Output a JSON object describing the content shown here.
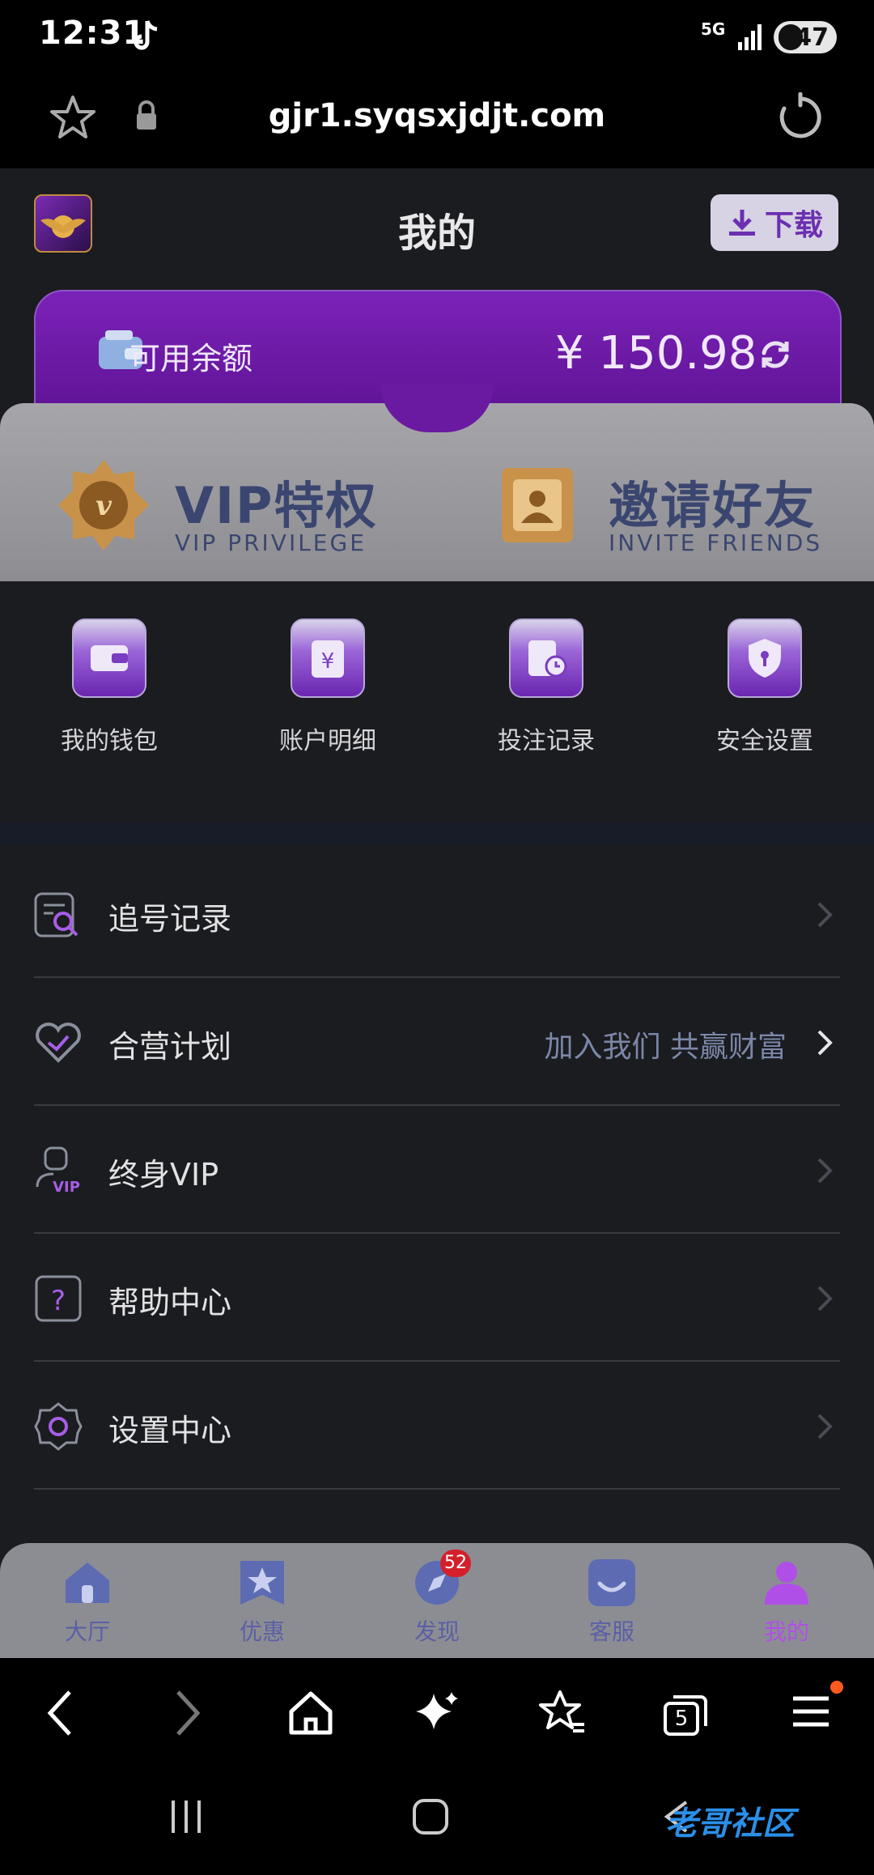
{
  "status_bar": {
    "time": "12:31",
    "network": "5G",
    "battery": "47"
  },
  "browser": {
    "url": "gjr1.syqsxjdjt.com"
  },
  "header": {
    "title": "我的",
    "download_label": "下载"
  },
  "balance": {
    "label": "可用余额",
    "value": "¥ 150.98"
  },
  "promo": [
    {
      "title": "VIP特权",
      "subtitle": "VIP PRIVILEGE"
    },
    {
      "title": "邀请好友",
      "subtitle": "INVITE FRIENDS"
    }
  ],
  "shortcuts": [
    "我的钱包",
    "账户明细",
    "投注记录",
    "安全设置"
  ],
  "menu": [
    {
      "label": "追号记录",
      "extra": ""
    },
    {
      "label": "合营计划",
      "extra": "加入我们 共赢财富"
    },
    {
      "label": "终身VIP",
      "extra": ""
    },
    {
      "label": "帮助中心",
      "extra": ""
    },
    {
      "label": "设置中心",
      "extra": ""
    }
  ],
  "tabs": [
    {
      "label": "大厅"
    },
    {
      "label": "优惠"
    },
    {
      "label": "发现",
      "badge": "52"
    },
    {
      "label": "客服"
    },
    {
      "label": "我的",
      "active": true
    }
  ],
  "browser_nav": {
    "tab_count": "5"
  },
  "watermark": "老哥社区",
  "colors": {
    "accent_purple": "#6b2fb0",
    "active_tab": "#b04fe8",
    "tab_label": "#5c5fa4"
  }
}
